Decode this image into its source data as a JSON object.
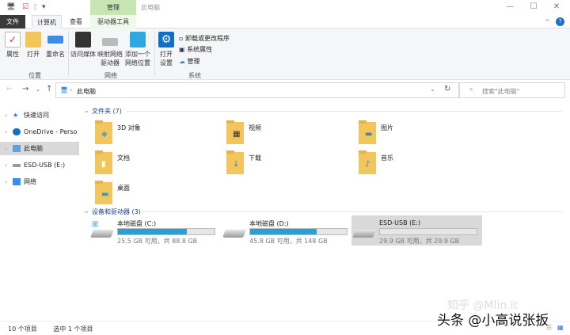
{
  "window": {
    "title": "此电脑",
    "manage_tab": "管理",
    "minimize": "—",
    "maximize": "☐",
    "close": "✕"
  },
  "tabs": [
    "文件",
    "计算机",
    "查看",
    "驱动器工具"
  ],
  "ribbon": {
    "location": {
      "label": "位置",
      "buttons": [
        "属性",
        "打开",
        "重命名"
      ]
    },
    "network": {
      "label": "网络",
      "buttons": [
        "访问媒体",
        "映射网络\n驱动器",
        "添加一个\n网络位置"
      ]
    },
    "system": {
      "label": "系统",
      "open_settings": "打开\n设置",
      "items": [
        "卸载或更改程序",
        "系统属性",
        "管理"
      ]
    }
  },
  "address": {
    "path": "此电脑",
    "search_placeholder": "搜索\"此电脑\""
  },
  "nav_pane": [
    "快速访问",
    "OneDrive - Personal",
    "此电脑",
    "ESD-USB (E:)",
    "网络"
  ],
  "folders_header": "文件夹 (7)",
  "folders": [
    "3D 对象",
    "视频",
    "图片",
    "文档",
    "下载",
    "音乐",
    "桌面"
  ],
  "drives_header": "设备和驱动器 (3)",
  "drives": [
    {
      "name": "本地磁盘 (C:)",
      "info": "25.5 GB 可用，共 88.8 GB",
      "used_pct": 71
    },
    {
      "name": "本地磁盘 (D:)",
      "info": "45.8 GB 可用，共 148 GB",
      "used_pct": 69
    },
    {
      "name": "ESD-USB (E:)",
      "info": "29.9 GB 可用，共 29.9 GB",
      "used_pct": 0
    }
  ],
  "status": {
    "count": "10 个项目",
    "selected": "选中 1 个项目"
  },
  "watermark": {
    "main": "头条 @小高说张扳",
    "faint": "知乎 @Mlin.it"
  },
  "colors": {
    "accent": "#26a0da",
    "manage": "#c8e6b4"
  }
}
